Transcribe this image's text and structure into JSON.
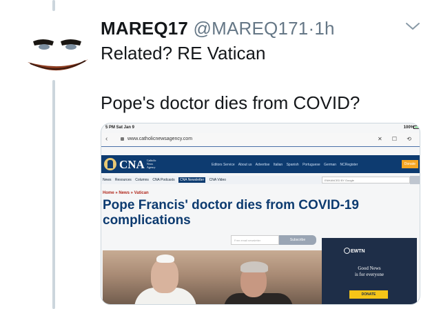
{
  "tweet": {
    "display_name": "MAREQ17",
    "handle": "@MAREQ171",
    "separator": "·",
    "time": "1h",
    "text_line1": "Related? RE Vatican",
    "text_line2": "Pope's doctor dies from COVID?"
  },
  "colors": {
    "text": "#14171a",
    "muted": "#657786",
    "thread_line": "#ccd6dd",
    "cna_blue": "#0d3b70",
    "donate_orange": "#f5a623"
  },
  "media": {
    "status_time": "5 PM  Sat Jan 9",
    "status_battery": "100%",
    "url": "www.catholicnewsagency.com",
    "url_actions": "✕ ☐ ⟲",
    "cna": {
      "logo": "CNA",
      "logo_sub": "Catholic News Agency",
      "nav": [
        "Editors Service",
        "About us",
        "Advertise",
        "Italian",
        "Spanish",
        "Portuguese",
        "German",
        "NCRegister"
      ],
      "donate": "Donate",
      "menu": [
        "News",
        "Resources",
        "Columns",
        "CNA Podcasts",
        "CNA Newsletter",
        "CNA Video"
      ],
      "menu_active": "CNA Newsletter",
      "search_placeholder": "ENHANCED BY Google",
      "breadcrumb": "Home » News » Vatican",
      "headline": "Pope Francis' doctor dies from COVID-19 complications",
      "newsletter_placeholder": "Free email newsletter",
      "subscribe": "Subscribe"
    },
    "ad": {
      "logo": "EWTN",
      "line1": "Good News",
      "line2": "is for everyone",
      "donate": "DONATE"
    }
  }
}
